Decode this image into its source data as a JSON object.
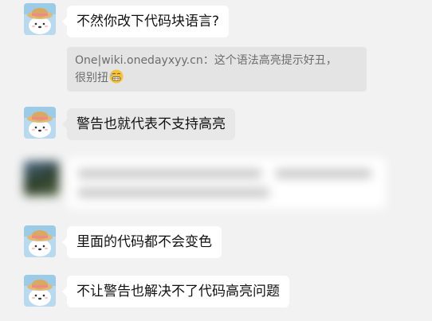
{
  "messages": [
    {
      "id": "msg1",
      "text": "不然你改下代码块语言?",
      "quote": {
        "author": "One|wiki.onedayxyy.cn：",
        "text_line1": "这个语法高亮提示好丑，",
        "text_line2": "很别扭",
        "emoji": "grimacing-emoji"
      }
    },
    {
      "id": "msg2",
      "text": "警告也就代表不支持高亮"
    },
    {
      "id": "msg3",
      "text": "[blurred message]",
      "blurred": true
    },
    {
      "id": "msg4",
      "text": "里面的代码都不会变色"
    },
    {
      "id": "msg5",
      "text": "不让警告也解决不了代码高亮问题"
    }
  ],
  "colors": {
    "background": "#f2f2f2",
    "bubble": "#ffffff",
    "bubble_grey": "#e8e8e8",
    "quote_background": "#e4e4e4",
    "quote_text": "#6c6c6c"
  },
  "icons": {
    "avatar": "cartoon-bear-hat-avatar-icon",
    "emoji": "grimacing-emoji"
  }
}
